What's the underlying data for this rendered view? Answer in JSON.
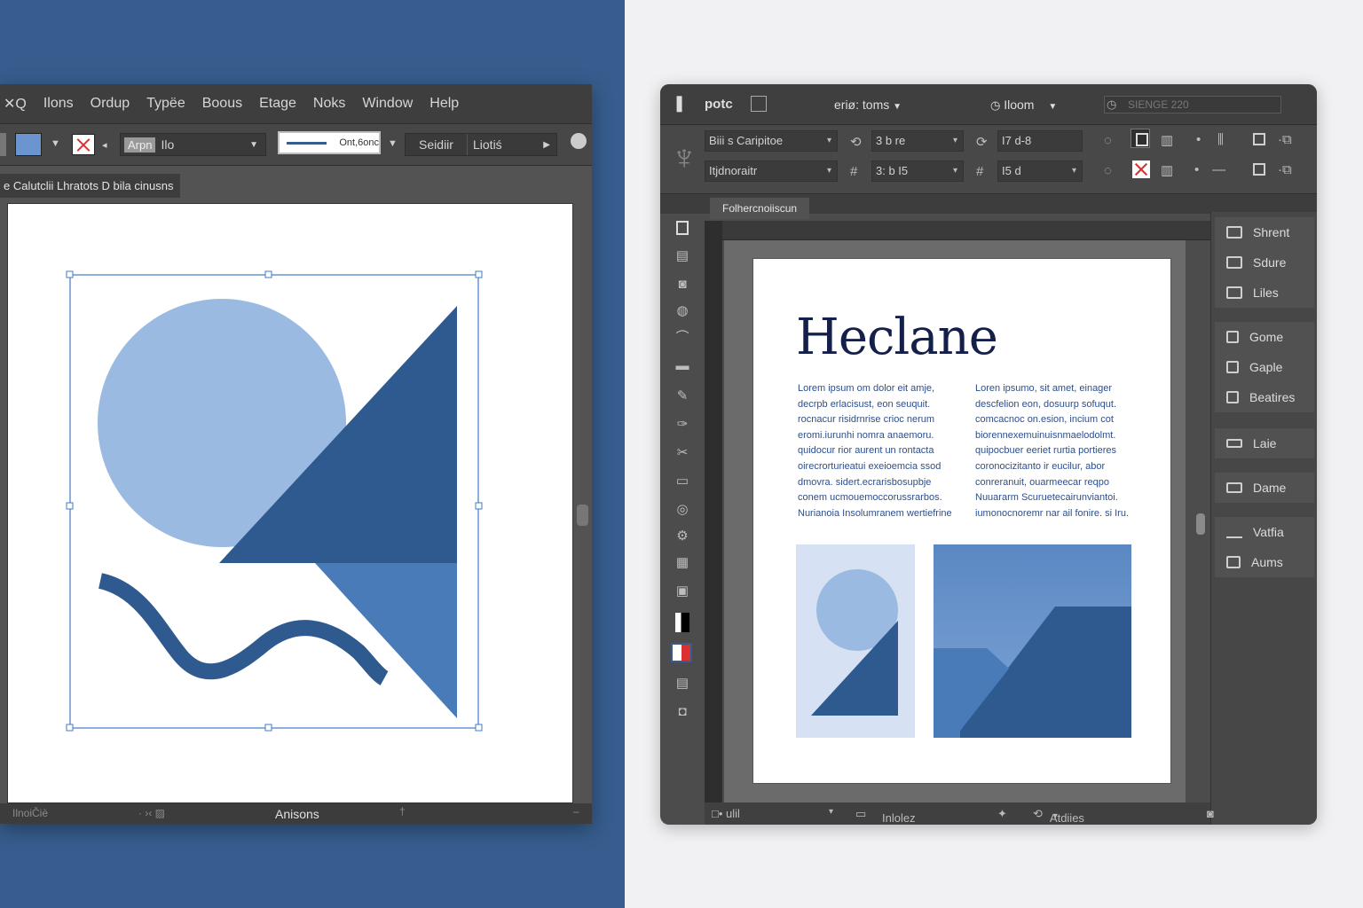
{
  "left_window": {
    "menu": [
      "✕Q",
      "Ilons",
      "Ordup",
      "Typëe",
      "Boous",
      "Etage",
      "Noks",
      "Window",
      "Help"
    ],
    "control": {
      "font_tag": "Arpn",
      "font_value": "Ilo",
      "stroke_value": "Ont,6onc",
      "seg_left": "Seidiir",
      "seg_right": "Liotiś"
    },
    "doc_tab": "e Calutclii Lhratots D bila cinusns",
    "status": {
      "left": "IlnoiČiè",
      "mid_icons": "· ›‹ ▨",
      "center": "Anisons",
      "pin": "†",
      "right": "–"
    }
  },
  "right_window": {
    "app_name": "potc",
    "workspace": "eriø: toms",
    "zoom_label": "Iloom",
    "search_placeholder": "SIENGE 220",
    "fields": {
      "row1_a": "Biii s Caripitoe",
      "row1_b": "3 b re",
      "row1_c": "I7 d-8",
      "row2_a": "Itjdnoraitr",
      "row2_b": "3: b I5",
      "row2_c": "I5 d"
    },
    "doc_tab": "Folhercnoiiscun",
    "page": {
      "heading": "Heclane",
      "col1": [
        "Lorem ipsum om dolor eit amje,",
        "decrpb erlacisust, eon seuquit.",
        "rocnacur risidrnrise crioc nerum",
        "eromi.iurunhi nomra anaemoru.",
        "quidocur rior aurent un rontacta",
        "oirecrorturieatui exeioemcia ssod",
        "dmovra. sidert.ecrarisbosupbje",
        "conem ucmouemoccorussrarbos.",
        "Nurianoia Insolumranem wertiefrine"
      ],
      "col2": [
        "Loren ipsumo, sit amet, einager",
        "descfelion eon, dosuurp sofuqut.",
        "comcacnoc on.esion, incium cot",
        "biorennexemuinuisnmaelodolmt.",
        "quipocbuer eeriet rurtia portieres",
        "coronocizitanto ir eucilur, abor",
        "conreranuit, ouarmeecar reqpo",
        "Nuuararm Scuruetecairunviantoi.",
        "iumonocnoremr nar ail fonire. si Iru."
      ]
    },
    "panel_groups": [
      [
        "Shrent",
        "Sdure",
        "Liles"
      ],
      [
        "Gome",
        "Gaple",
        "Beatires"
      ],
      [
        "Laie"
      ],
      [
        "Dame"
      ],
      [
        "Vatfia",
        "Aums"
      ]
    ],
    "status": {
      "item1": "□• ulil",
      "item2": "Inlolez Gimoro",
      "item3": "Atdiies"
    }
  },
  "colors": {
    "brand_blue": "#365d8d",
    "dark_blue": "#2e5a8f",
    "mid_blue": "#4a7bb9",
    "light_blue": "#9bbae1",
    "heading_navy": "#14204a"
  }
}
